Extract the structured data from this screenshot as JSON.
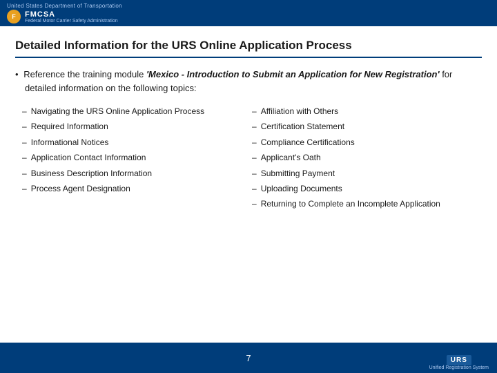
{
  "header": {
    "gov_text": "United States Department of Transportation",
    "fmcsa_acronym": "F",
    "fmcsa_title": "FMCSA",
    "fmcsa_subtitle": "Federal Motor Carrier Safety Administration"
  },
  "page": {
    "title": "Detailed Information for the URS Online Application Process",
    "intro_bullet": "Reference the training module ",
    "intro_italic": "'Mexico - Introduction to Submit an Application for New Registration'",
    "intro_suffix": " for detailed information on the following topics:",
    "left_column": [
      "Navigating the URS Online Application Process",
      "Required Information",
      "Informational Notices",
      "Application Contact Information",
      "Business Description Information",
      "Process Agent Designation"
    ],
    "right_column": [
      "Affiliation with Others",
      "Certification Statement",
      "Compliance Certifications",
      "Applicant's Oath",
      "Submitting Payment",
      "Uploading Documents",
      "Returning to Complete an Incomplete Application"
    ],
    "page_number": "7"
  },
  "footer": {
    "urs_label": "URS",
    "urs_subtext": "Unified Registration System"
  }
}
